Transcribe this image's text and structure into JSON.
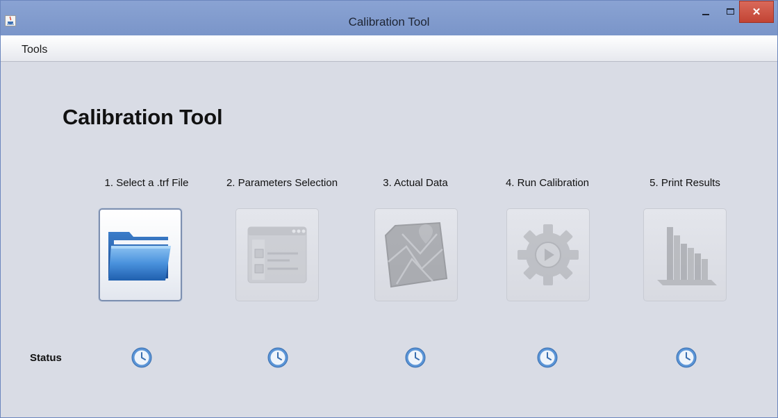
{
  "window": {
    "title": "Calibration Tool",
    "close_glyph": "✕"
  },
  "menu": {
    "items": [
      {
        "label": "Tools"
      }
    ]
  },
  "main": {
    "title": "Calibration Tool",
    "status_label": "Status",
    "steps": [
      {
        "label": "1. Select a .trf File",
        "icon": "folder-icon",
        "state": "enabled"
      },
      {
        "label": "2. Parameters Selection",
        "icon": "parameters-form-icon",
        "state": "disabled"
      },
      {
        "label": "3. Actual Data",
        "icon": "map-icon",
        "state": "disabled"
      },
      {
        "label": "4. Run Calibration",
        "icon": "gear-play-icon",
        "state": "disabled"
      },
      {
        "label": "5. Print Results",
        "icon": "bar-chart-icon",
        "state": "disabled"
      }
    ],
    "status_icons": [
      "clock-icon",
      "clock-icon",
      "clock-icon",
      "clock-icon",
      "clock-icon"
    ]
  },
  "colors": {
    "titlebar": "#7a95c9",
    "close_button": "#c8493a",
    "content_bg": "#d9dce5",
    "clock_blue": "#5a94d6"
  }
}
